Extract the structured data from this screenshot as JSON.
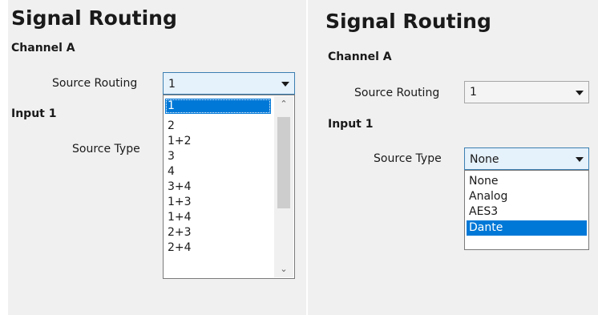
{
  "left": {
    "title": "Signal Routing",
    "channel_label": "Channel A",
    "source_routing_label": "Source Routing",
    "source_routing_value": "1",
    "input_label": "Input 1",
    "source_type_label": "Source Type",
    "routing_options": [
      "1",
      "2",
      "1+2",
      "3",
      "4",
      "3+4",
      "1+3",
      "1+4",
      "2+3",
      "2+4"
    ],
    "routing_selected_option": "1",
    "dropdown_open": true,
    "scrollbar_up_icon": "chevron-up-icon",
    "scrollbar_down_icon": "chevron-down-icon"
  },
  "right": {
    "title": "Signal Routing",
    "channel_label": "Channel A",
    "source_routing_label": "Source Routing",
    "source_routing_value": "1",
    "input_label": "Input 1",
    "source_type_label": "Source Type",
    "source_type_value": "None",
    "type_options": [
      "None",
      "Analog",
      "AES3",
      "Dante"
    ],
    "type_highlighted_option": "Dante",
    "dropdown_open": true
  },
  "colors": {
    "panel_bg": "#f0f0f0",
    "highlight": "#0078d7",
    "open_combo_bg": "#e5f1fb",
    "open_combo_border": "#3c7fb1"
  }
}
